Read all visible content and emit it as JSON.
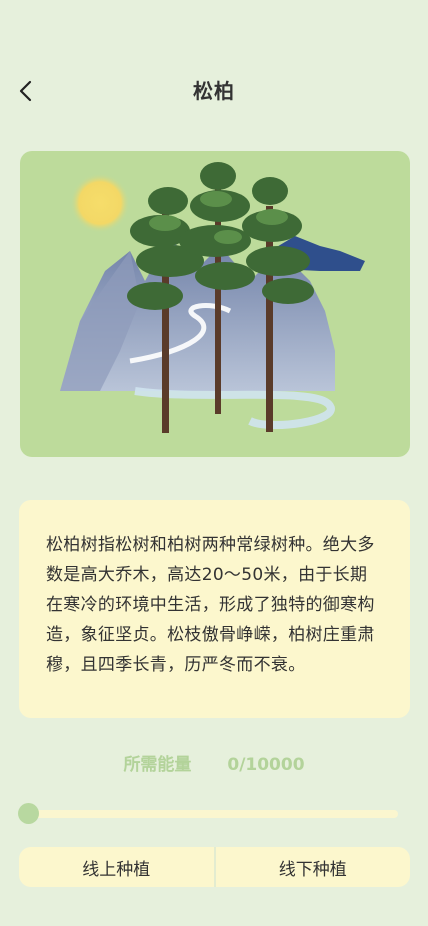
{
  "header": {
    "title": "松柏",
    "back_icon": "chevron-left-icon"
  },
  "hero": {
    "image": "pine-cypress-illustration"
  },
  "description": "松柏树指松树和柏树两种常绿树种。绝大多数是高大乔木，高达20～50米，由于长期在寒冷的环境中生活，形成了独特的御寒构造，象征坚贞。松枝傲骨峥嵘，柏树庄重肃穆，且四季长青，历严冬而不衰。",
  "energy": {
    "label": "所需能量",
    "value": "0/10000",
    "progress": 0
  },
  "actions": {
    "online_label": "线上种植",
    "offline_label": "线下种植"
  },
  "colors": {
    "background": "#e6f0dc",
    "card": "#fcf7cd",
    "accent": "#b3d39a"
  }
}
